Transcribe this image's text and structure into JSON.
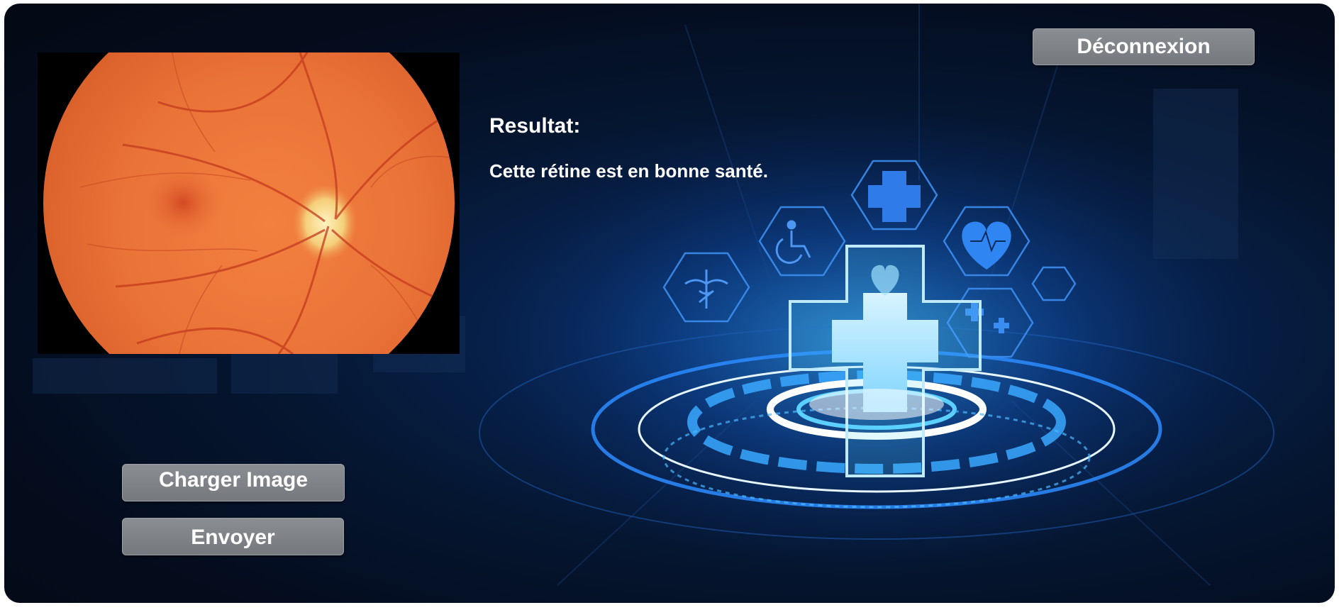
{
  "header": {
    "logout_label": "Déconnexion"
  },
  "result": {
    "title": "Resultat:",
    "message": "Cette rétine est en bonne santé."
  },
  "actions": {
    "load_label": "Charger Image",
    "send_label": "Envoyer"
  },
  "preview": {
    "alt": "retina fundus image"
  },
  "colors": {
    "background_dark": "#040c1d",
    "accent_blue": "#1e8cff",
    "button_gray": "#7f8388",
    "retina_orange": "#e8743c"
  },
  "icons": [
    "medical-cross-icon",
    "wheelchair-icon",
    "heart-pulse-icon",
    "caduceus-icon",
    "hexagon-grid-icon"
  ]
}
